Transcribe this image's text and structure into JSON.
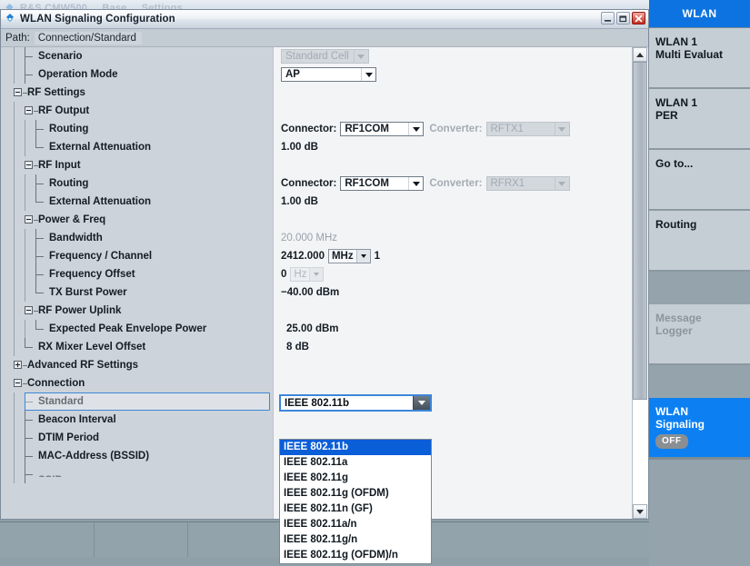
{
  "behind_window": {
    "title": "R&S CMW500 ... Base ... Settings"
  },
  "window": {
    "title": "WLAN Signaling Configuration",
    "icon": "rohde-schwarz-logo-icon",
    "buttons": {
      "minimize": "minimize-icon",
      "restore": "restore-icon",
      "close": "close-icon"
    }
  },
  "pathbar": {
    "label": "Path:",
    "value": "Connection/Standard"
  },
  "rows": [
    {
      "label": "Scenario",
      "level": 1,
      "kind": "leaf",
      "value_type": "combo_disabled",
      "value": "Standard Cell"
    },
    {
      "label": "Operation Mode",
      "level": 1,
      "kind": "leaf",
      "value_type": "combo",
      "value": "AP"
    },
    {
      "label": "RF Settings",
      "level": 0,
      "kind": "expanded",
      "value_type": "none",
      "value": ""
    },
    {
      "label": "RF Output",
      "level": 1,
      "kind": "expanded",
      "value_type": "none",
      "value": ""
    },
    {
      "label": "Routing",
      "level": 2,
      "kind": "leaf",
      "value_type": "connector",
      "value": ""
    },
    {
      "label": "External Attenuation",
      "level": 2,
      "kind": "leaf_last",
      "value_type": "text",
      "value": "1.00 dB"
    },
    {
      "label": "RF Input",
      "level": 1,
      "kind": "expanded",
      "value_type": "none",
      "value": ""
    },
    {
      "label": "Routing",
      "level": 2,
      "kind": "leaf",
      "value_type": "connector2",
      "value": ""
    },
    {
      "label": "External Attenuation",
      "level": 2,
      "kind": "leaf_last",
      "value_type": "text",
      "value": "1.00 dB"
    },
    {
      "label": "Power & Freq",
      "level": 1,
      "kind": "expanded",
      "value_type": "none",
      "value": ""
    },
    {
      "label": "Bandwidth",
      "level": 2,
      "kind": "leaf",
      "value_type": "text_dim",
      "value": "20.000 MHz"
    },
    {
      "label": "Frequency / Channel",
      "level": 2,
      "kind": "leaf",
      "value_type": "freq",
      "value": ""
    },
    {
      "label": "Frequency Offset",
      "level": 2,
      "kind": "leaf",
      "value_type": "offset",
      "value": ""
    },
    {
      "label": "TX Burst Power",
      "level": 2,
      "kind": "leaf_last",
      "value_type": "text",
      "value": "−40.00 dBm"
    },
    {
      "label": "RF Power Uplink",
      "level": 1,
      "kind": "expanded",
      "value_type": "none",
      "value": ""
    },
    {
      "label": "Expected Peak Envelope Power",
      "level": 2,
      "kind": "leaf_last",
      "value_type": "text_pad",
      "value": "25.00  dBm"
    },
    {
      "label": "RX Mixer Level Offset",
      "level": 1,
      "kind": "leaf_last",
      "value_type": "text_pad",
      "value": "8  dB"
    },
    {
      "label": "Advanced RF Settings",
      "level": 0,
      "kind": "collapsed",
      "value_type": "none",
      "value": ""
    },
    {
      "label": "Connection",
      "level": 0,
      "kind": "expanded",
      "value_type": "none",
      "value": ""
    },
    {
      "label": "Standard",
      "level": 1,
      "kind": "leaf",
      "value_type": "standard",
      "value": ""
    },
    {
      "label": "Beacon Interval",
      "level": 1,
      "kind": "leaf",
      "value_type": "none",
      "value": ""
    },
    {
      "label": "DTIM Period",
      "level": 1,
      "kind": "leaf",
      "value_type": "none",
      "value": ""
    },
    {
      "label": "MAC-Address (BSSID)",
      "level": 1,
      "kind": "leaf",
      "value_type": "none",
      "value": ""
    },
    {
      "label": "SSID",
      "level": 1,
      "kind": "leaf_clip",
      "value_type": "none",
      "value": ""
    }
  ],
  "routing_tx": {
    "connector_label": "Connector:",
    "connector_value": "RF1COM",
    "converter_label": "Converter:",
    "converter_value": "RFTX1"
  },
  "routing_rx": {
    "connector_label": "Connector:",
    "connector_value": "RF1COM",
    "converter_label": "Converter:",
    "converter_value": "RFRX1"
  },
  "frequency": {
    "value": "2412.000",
    "unit": "MHz",
    "channel": "1"
  },
  "frequency_offset": {
    "value": "0",
    "unit": "Hz"
  },
  "standard_field": {
    "selected": "IEEE 802.11b",
    "options": [
      "IEEE 802.11b",
      "IEEE 802.11a",
      "IEEE 802.11g",
      "IEEE 802.11g (OFDM)",
      "IEEE 802.11n (GF)",
      "IEEE 802.11a/n",
      "IEEE 802.11g/n",
      "IEEE 802.11g (OFDM)/n"
    ],
    "selected_index": 0
  },
  "sidebar": {
    "header": "WLAN",
    "keys": [
      {
        "label_line1": "WLAN 1",
        "label_line2": "Multi Evaluat",
        "state": "normal"
      },
      {
        "label_line1": "WLAN 1",
        "label_line2": "PER",
        "state": "normal"
      },
      {
        "label_line1": "Go to...",
        "label_line2": "",
        "state": "normal"
      },
      {
        "label_line1": "Routing",
        "label_line2": "",
        "state": "normal"
      },
      {
        "label_line1": "",
        "label_line2": "",
        "state": "gap"
      },
      {
        "label_line1": "Message",
        "label_line2": "Logger",
        "state": "disabled"
      },
      {
        "label_line1": "",
        "label_line2": "",
        "state": "gap"
      },
      {
        "label_line1": "WLAN",
        "label_line2": "Signaling",
        "state": "active",
        "badge": "OFF"
      }
    ]
  },
  "colors": {
    "accent_blue": "#0c73e0",
    "active_key": "#0c80f2",
    "selection_blue": "#0a5ed8",
    "focus_border": "#3c86d8",
    "window_bg": "#cfd6dd",
    "tree_bg": "#ccd3da",
    "value_bg": "#f3f4f6",
    "sidebar_bg": "#95a4ac",
    "softkey_bg": "#c6ced5",
    "status_bg": "#93a3ab",
    "close_red": "#c0291c"
  }
}
